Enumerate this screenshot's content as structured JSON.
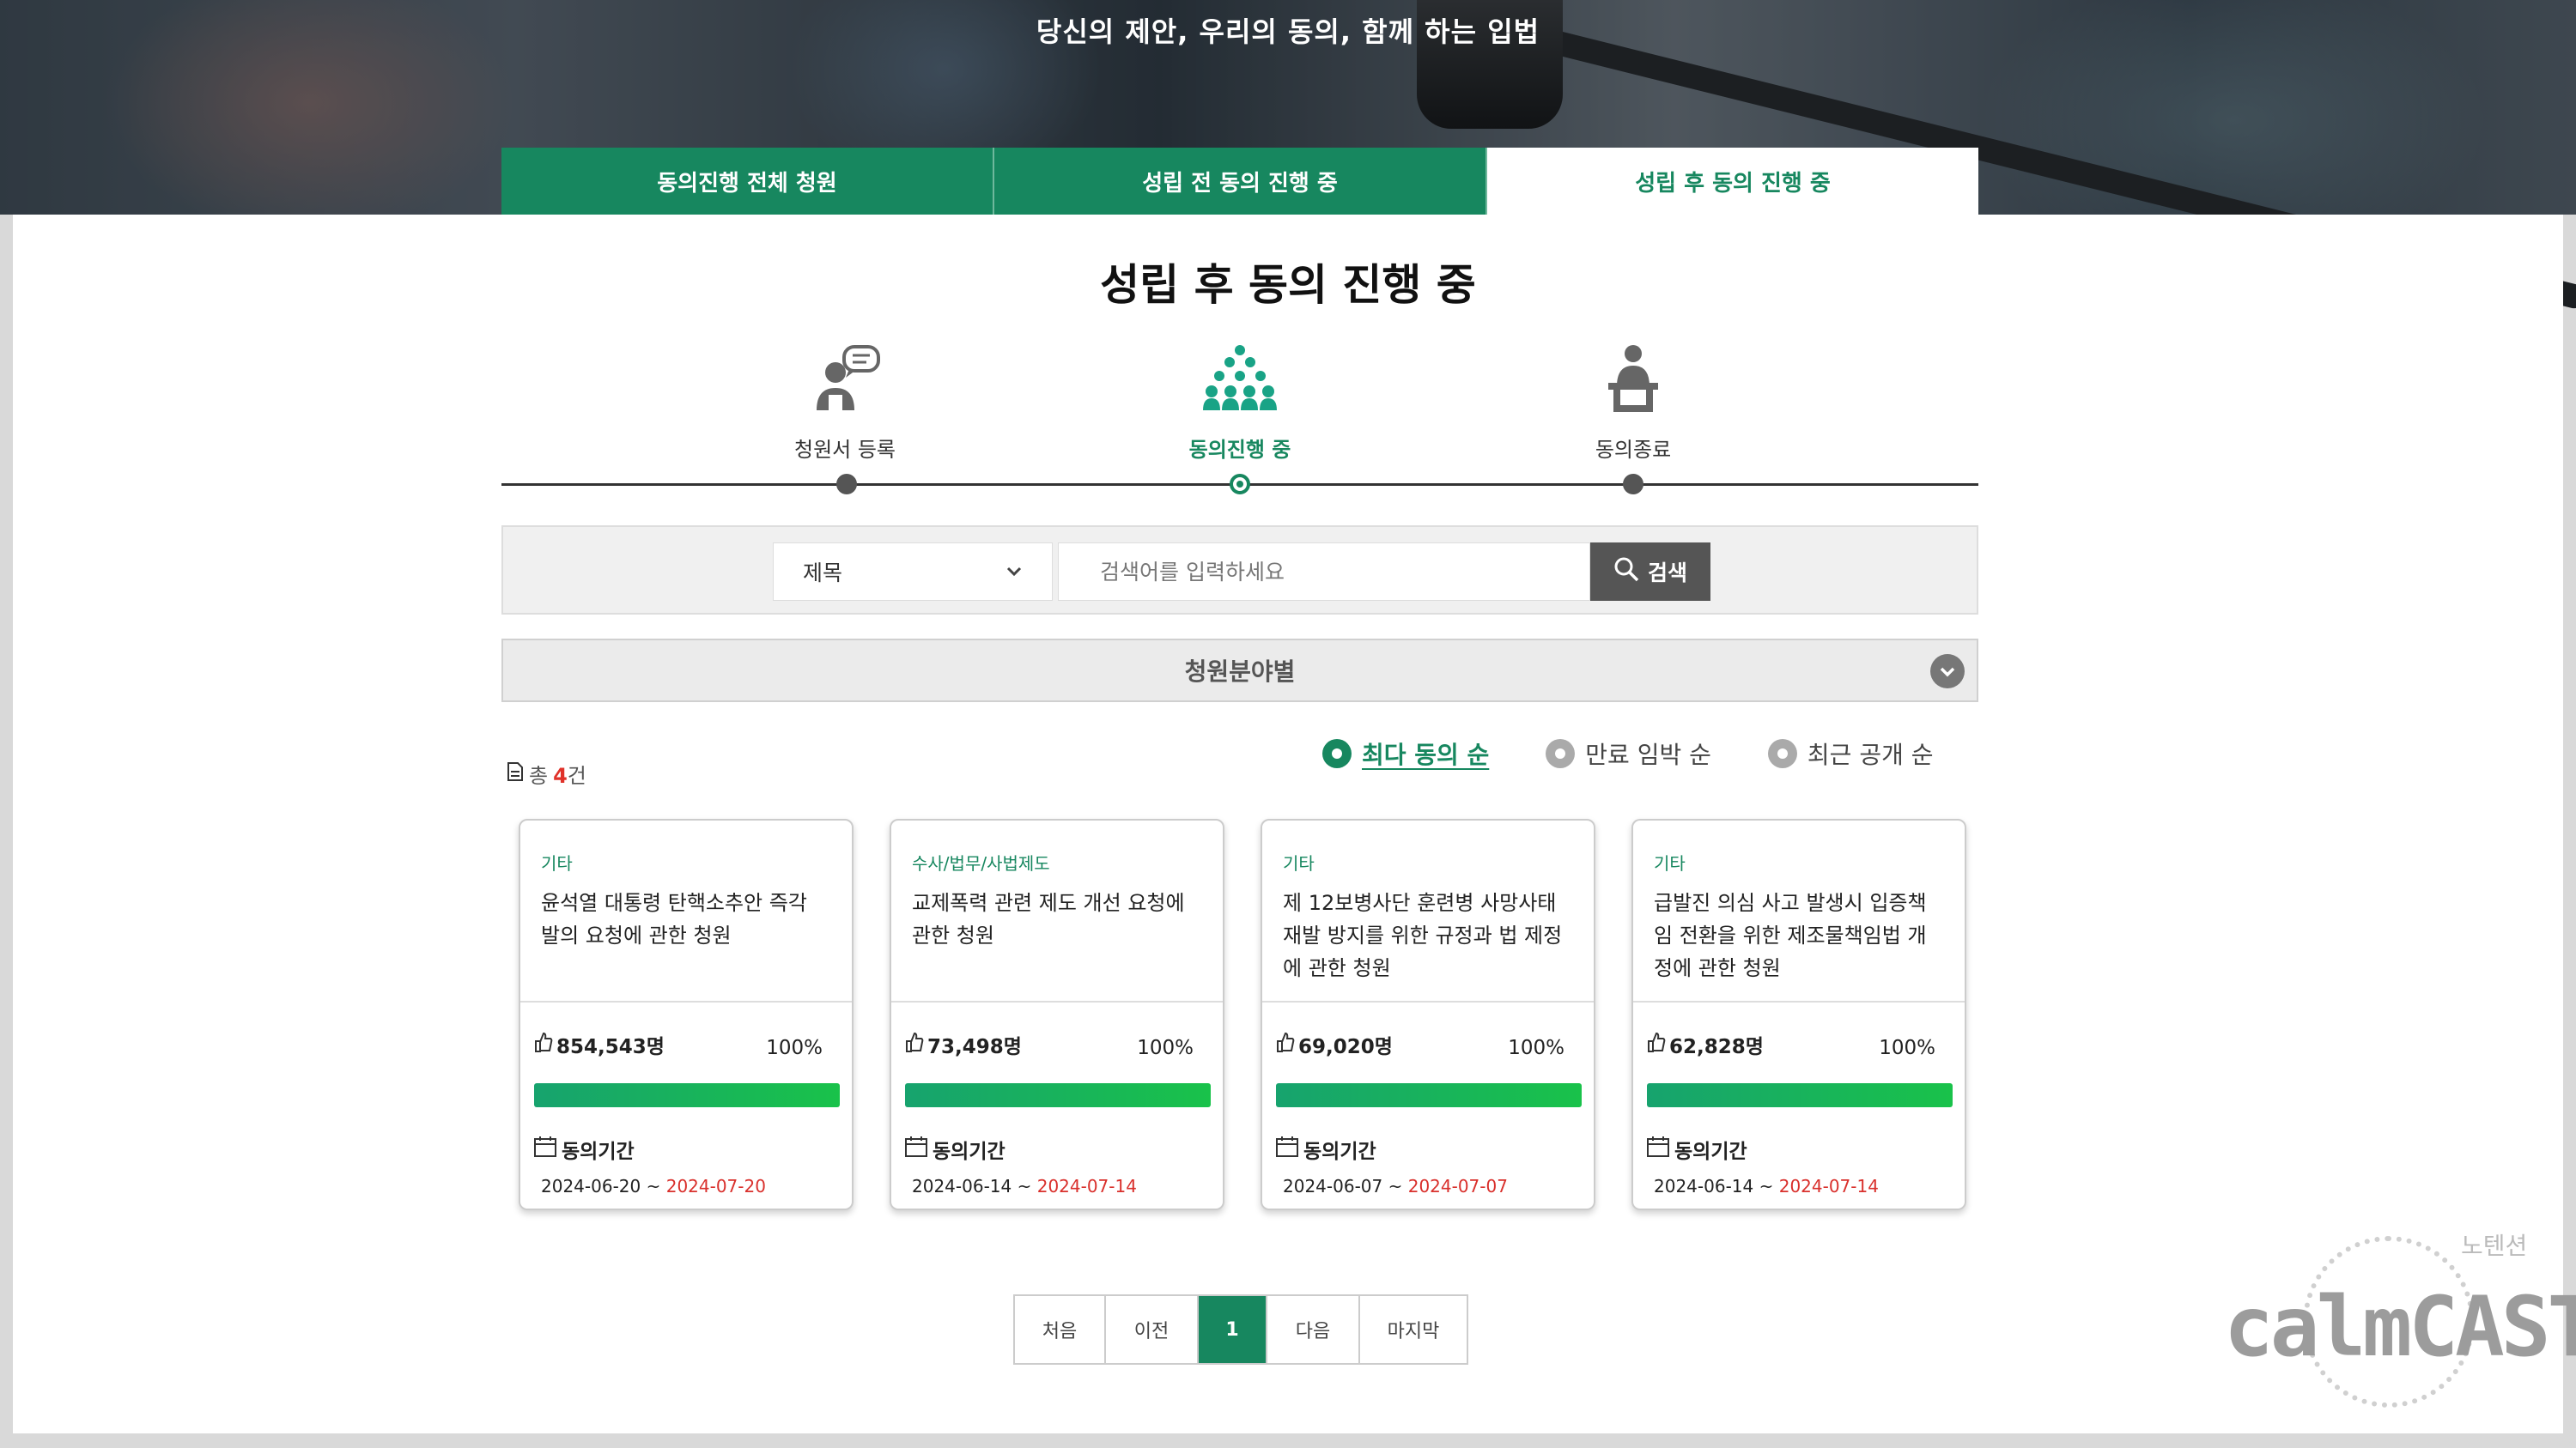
{
  "hero": {
    "title": "당신의 제안, 우리의 동의, 함께 하는 입법"
  },
  "tabs": [
    {
      "label": "동의진행 전체 청원",
      "active": false
    },
    {
      "label": "성립 전 동의 진행 중",
      "active": false
    },
    {
      "label": "성립 후 동의 진행 중",
      "active": true
    }
  ],
  "page_title": "성립 후 동의 진행 중",
  "steps": [
    {
      "label": "청원서 등록",
      "icon": "speech-person-icon",
      "active": false
    },
    {
      "label": "동의진행 중",
      "icon": "crowd-icon",
      "active": true
    },
    {
      "label": "동의종료",
      "icon": "podium-person-icon",
      "active": false
    }
  ],
  "search": {
    "field_selected": "제목",
    "placeholder": "검색어를 입력하세요",
    "button_label": "검색",
    "button_icon": "search-icon"
  },
  "category_filter": {
    "label": "청원분야별",
    "icon": "chevron-down-icon"
  },
  "total": {
    "prefix": "총",
    "count": "4",
    "suffix": "건"
  },
  "sort_options": [
    {
      "label": "최다 동의 순",
      "active": true
    },
    {
      "label": "만료 임박 순",
      "active": false
    },
    {
      "label": "최근 공개 순",
      "active": false
    }
  ],
  "cards": [
    {
      "category": "기타",
      "title": "윤석열 대통령 탄핵소추안 즉각 발의 요청에 관한 청원",
      "count": "854,543명",
      "percent": "100%",
      "progress": 1.0,
      "period_label": "동의기간",
      "start": "2024-06-20",
      "end": "2024-07-20"
    },
    {
      "category": "수사/법무/사법제도",
      "title": "교제폭력 관련 제도 개선 요청에 관한 청원",
      "count": "73,498명",
      "percent": "100%",
      "progress": 1.0,
      "period_label": "동의기간",
      "start": "2024-06-14",
      "end": "2024-07-14"
    },
    {
      "category": "기타",
      "title": "제 12보병사단 훈련병 사망사태 재발 방지를 위한 규정과 법 제정에 관한 청원",
      "count": "69,020명",
      "percent": "100%",
      "progress": 1.0,
      "period_label": "동의기간",
      "start": "2024-06-07",
      "end": "2024-07-07"
    },
    {
      "category": "기타",
      "title": "급발진 의심 사고 발생시 입증책임 전환을 위한 제조물책임법 개정에 관한 청원",
      "count": "62,828명",
      "percent": "100%",
      "progress": 1.0,
      "period_label": "동의기간",
      "start": "2024-06-14",
      "end": "2024-07-14"
    }
  ],
  "pagination": {
    "first": "처음",
    "prev": "이전",
    "current": "1",
    "next": "다음",
    "last": "마지막"
  },
  "watermark": {
    "brand": "calmCAST",
    "sub": "노텐션"
  },
  "colors": {
    "accent": "#17875f",
    "deadline": "#d9302c",
    "progress": "#19c24a"
  }
}
